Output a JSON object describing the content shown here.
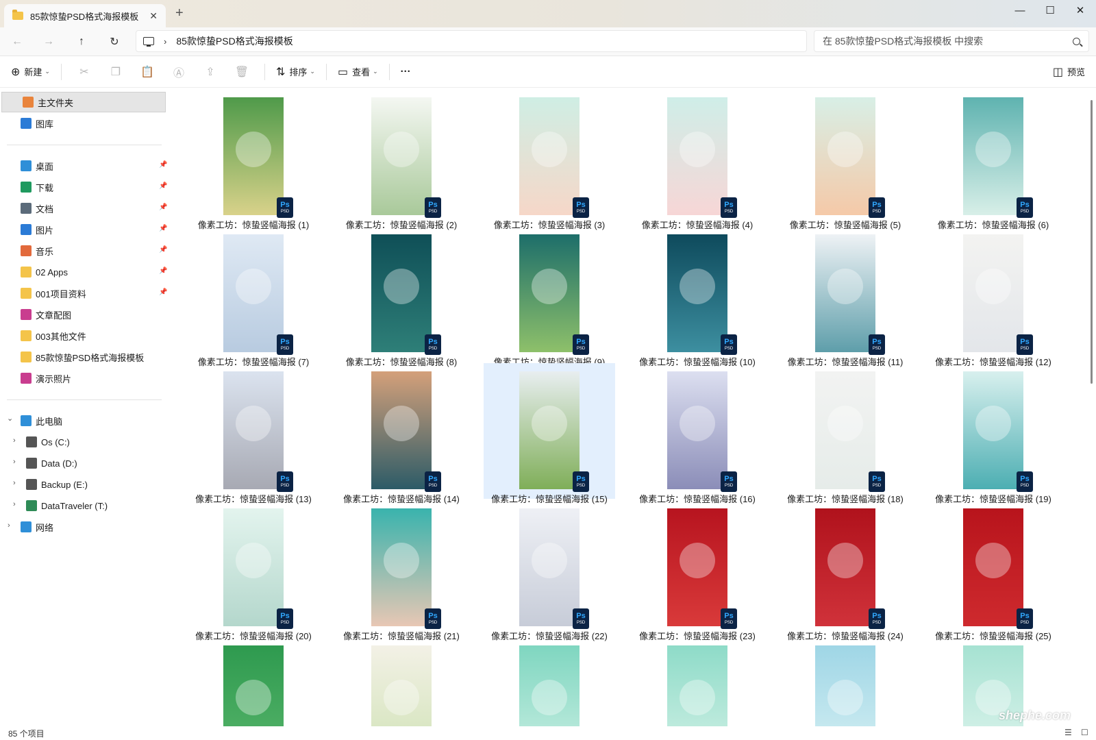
{
  "window": {
    "tab_title": "85款惊蛰PSD格式海报模板",
    "tab_close": "✕",
    "new_tab": "+",
    "min": "—",
    "max": "☐",
    "close": "✕"
  },
  "nav": {
    "back": "←",
    "forward": "→",
    "up": "↑",
    "refresh": "↻",
    "chevron": "›",
    "path": "85款惊蛰PSD格式海报模板",
    "search_placeholder": "在 85款惊蛰PSD格式海报模板 中搜索"
  },
  "toolbar": {
    "new_label": "新建",
    "sort_label": "排序",
    "view_label": "查看",
    "more": "···",
    "preview_label": "预览"
  },
  "sidebar": {
    "home": "主文件夹",
    "gallery": "图库",
    "quick": [
      {
        "label": "桌面",
        "color": "#2f8fd8"
      },
      {
        "label": "下载",
        "color": "#1f9a5f"
      },
      {
        "label": "文档",
        "color": "#5b6b7a"
      },
      {
        "label": "图片",
        "color": "#2b7bd6"
      },
      {
        "label": "音乐",
        "color": "#e26a3c"
      },
      {
        "label": "02 Apps",
        "color": "#f4c44a"
      },
      {
        "label": "001项目资料",
        "color": "#f4c44a"
      },
      {
        "label": "文章配图",
        "color": "#c93d8f"
      },
      {
        "label": "003其他文件",
        "color": "#f4c44a"
      },
      {
        "label": "85款惊蛰PSD格式海报模板",
        "color": "#f4c44a"
      },
      {
        "label": "演示照片",
        "color": "#c93d8f"
      }
    ],
    "this_pc": "此电脑",
    "drives": [
      "Os (C:)",
      "Data (D:)",
      "Backup (E:)",
      "DataTraveler (T:)"
    ],
    "network": "网络"
  },
  "files": [
    {
      "name": "像素工坊：惊蛰竖幅海报 (1)",
      "c1": "#4f9a4a",
      "c2": "#d9d28a"
    },
    {
      "name": "像素工坊：惊蛰竖幅海报 (2)",
      "c1": "#f4f7f2",
      "c2": "#a9c99a"
    },
    {
      "name": "像素工坊：惊蛰竖幅海报 (3)",
      "c1": "#cfeee4",
      "c2": "#f6d7c8"
    },
    {
      "name": "像素工坊：惊蛰竖幅海报 (4)",
      "c1": "#cfeee8",
      "c2": "#f7d6d6"
    },
    {
      "name": "像素工坊：惊蛰竖幅海报 (5)",
      "c1": "#d8efe6",
      "c2": "#f5c9a8"
    },
    {
      "name": "像素工坊：惊蛰竖幅海报 (6)",
      "c1": "#5fb3b0",
      "c2": "#d8efe8"
    },
    {
      "name": "像素工坊：惊蛰竖幅海报 (7)",
      "c1": "#dfe9f4",
      "c2": "#b8cbe0"
    },
    {
      "name": "像素工坊：惊蛰竖幅海报 (8)",
      "c1": "#0f4f57",
      "c2": "#2e7f78"
    },
    {
      "name": "像素工坊：惊蛰竖幅海报 (9)",
      "c1": "#1d6e6a",
      "c2": "#8ec06a"
    },
    {
      "name": "像素工坊：惊蛰竖幅海报 (10)",
      "c1": "#0e4a5c",
      "c2": "#3d8fa0"
    },
    {
      "name": "像素工坊：惊蛰竖幅海报 (11)",
      "c1": "#eef2f5",
      "c2": "#5e9eaa"
    },
    {
      "name": "像素工坊：惊蛰竖幅海报 (12)",
      "c1": "#f3f3f1",
      "c2": "#e3e6ea"
    },
    {
      "name": "像素工坊：惊蛰竖幅海报 (13)",
      "c1": "#dbe3ef",
      "c2": "#a7a9b3"
    },
    {
      "name": "像素工坊：惊蛰竖幅海报 (14)",
      "c1": "#d4a07a",
      "c2": "#2c5b67"
    },
    {
      "name": "像素工坊：惊蛰竖幅海报 (15)",
      "c1": "#e8eef0",
      "c2": "#7fae58"
    },
    {
      "name": "像素工坊：惊蛰竖幅海报 (16)",
      "c1": "#dcdff0",
      "c2": "#8b8db8"
    },
    {
      "name": "像素工坊：惊蛰竖幅海报 (18)",
      "c1": "#f2f3f2",
      "c2": "#e6ece9"
    },
    {
      "name": "像素工坊：惊蛰竖幅海报 (19)",
      "c1": "#d8f0ee",
      "c2": "#4caeb2"
    },
    {
      "name": "像素工坊：惊蛰竖幅海报 (20)",
      "c1": "#e3f4ee",
      "c2": "#b4d7cc"
    },
    {
      "name": "像素工坊：惊蛰竖幅海报 (21)",
      "c1": "#39b3ad",
      "c2": "#e8c7b4"
    },
    {
      "name": "像素工坊：惊蛰竖幅海报 (22)",
      "c1": "#eef0f5",
      "c2": "#c7ccd8"
    },
    {
      "name": "像素工坊：惊蛰竖幅海报 (23)",
      "c1": "#b7141f",
      "c2": "#d93a3a"
    },
    {
      "name": "像素工坊：惊蛰竖幅海报 (24)",
      "c1": "#b0121c",
      "c2": "#d0323a"
    },
    {
      "name": "像素工坊：惊蛰竖幅海报 (25)",
      "c1": "#b8141c",
      "c2": "#ce2a2e"
    },
    {
      "name": "",
      "c1": "#2e9a4f",
      "c2": "#58b56b"
    },
    {
      "name": "",
      "c1": "#f3f1e6",
      "c2": "#cfe2b5"
    },
    {
      "name": "",
      "c1": "#7fd6c0",
      "c2": "#caefe3"
    },
    {
      "name": "",
      "c1": "#8edbc8",
      "c2": "#d2f1e6"
    },
    {
      "name": "",
      "c1": "#9fd6e6",
      "c2": "#d6f0f3"
    },
    {
      "name": "",
      "c1": "#a6e2d2",
      "c2": "#e0f5ee"
    }
  ],
  "selected_index": 14,
  "badge": {
    "ps": "Ps",
    "psd": "PSD"
  },
  "status": {
    "count": "85 个项目"
  },
  "watermark": "shephe.com"
}
